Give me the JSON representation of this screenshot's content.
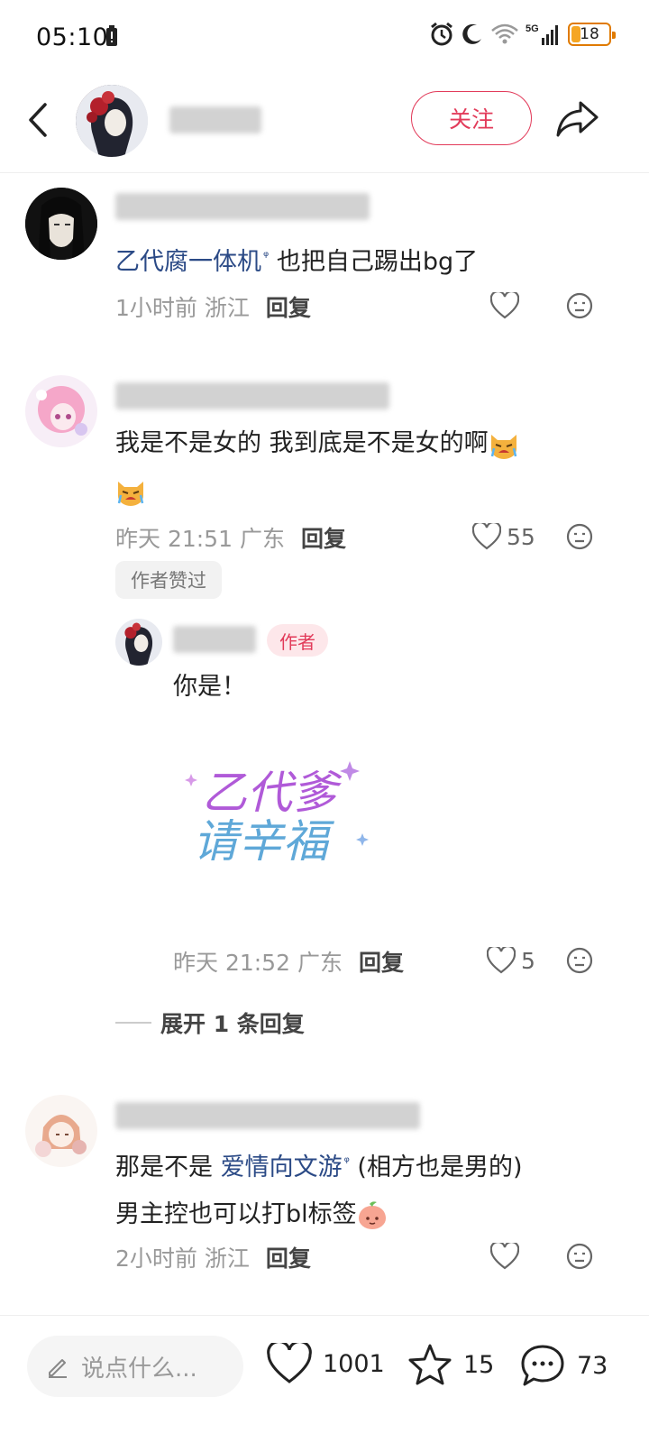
{
  "status_bar": {
    "time": "05:10",
    "battery": "18",
    "network": "5G"
  },
  "header": {
    "follow_label": "关注"
  },
  "comments": [
    {
      "link": "乙代腐一体机",
      "text": "也把自己踢出bg了",
      "meta": "1小时前 浙江",
      "reply": "回复",
      "likes": ""
    },
    {
      "text": "我是不是女的 我到底是不是女的啊",
      "meta": "昨天 21:51 广东",
      "reply": "回复",
      "likes": "55",
      "badge": "作者赞过",
      "sub_reply": {
        "author_tag": "作者",
        "text": "你是！",
        "sticker_text": "乙代爹 请辛福",
        "meta": "昨天 21:52 广东",
        "reply": "回复",
        "likes": "5"
      },
      "expand_label": "展开 1 条回复"
    },
    {
      "text_before": "那是不是",
      "link": "爱情向文游",
      "text_after": "(相方也是男的)",
      "text_line2": "男主控也可以打bl标签",
      "meta": "2小时前 浙江",
      "reply": "回复",
      "likes": ""
    }
  ],
  "bottom_bar": {
    "input_placeholder": "说点什么...",
    "likes": "1001",
    "favorites": "15",
    "comments": "73"
  },
  "colors": {
    "accent": "#e23b5a",
    "link": "#2b4a86"
  }
}
